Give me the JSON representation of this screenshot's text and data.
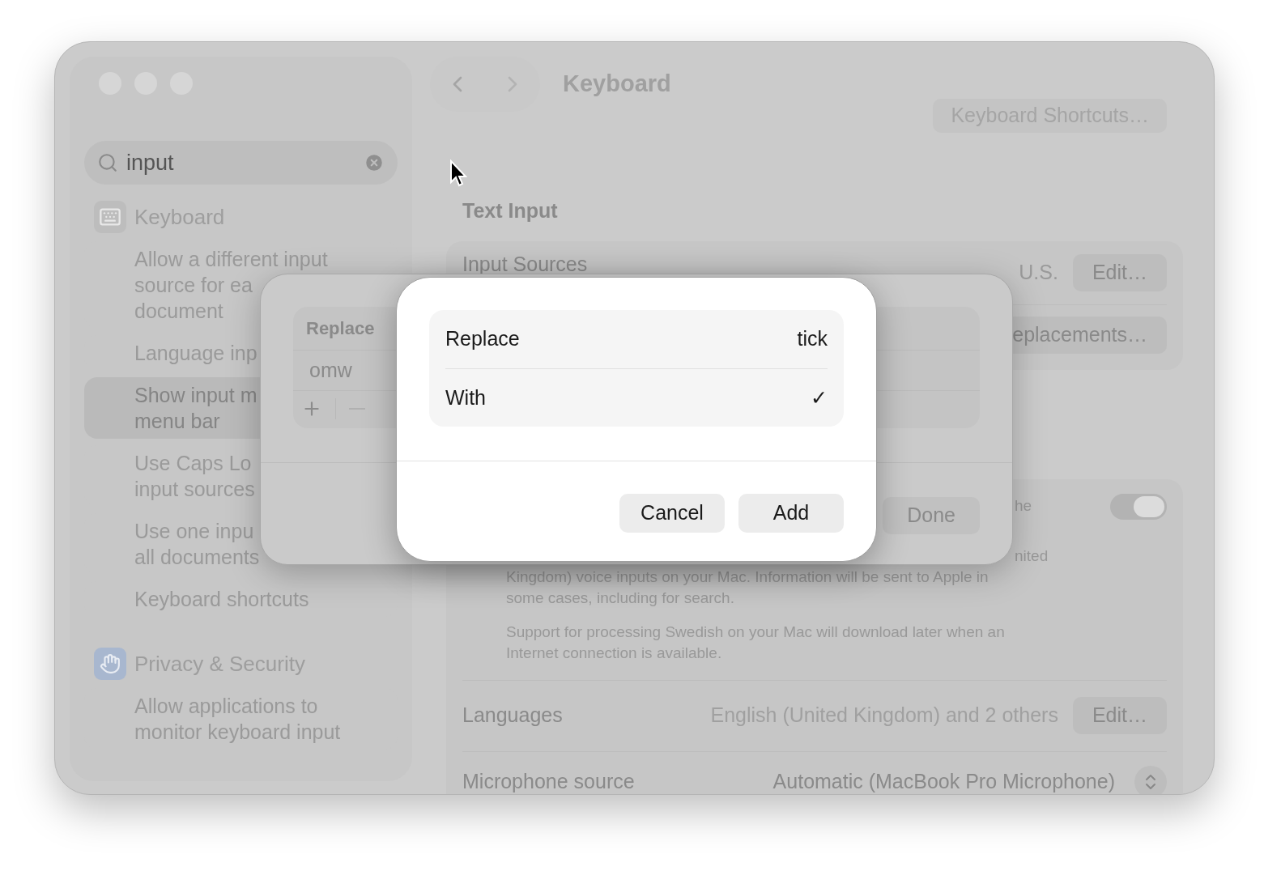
{
  "sidebar": {
    "search": {
      "value": "input"
    },
    "groups": [
      {
        "title": "Keyboard",
        "kind": "keyboard",
        "items": [
          {
            "lines": [
              "Allow a different input",
              "source for ea",
              "document"
            ],
            "selected": false
          },
          {
            "lines": [
              "Language inp"
            ],
            "selected": false
          },
          {
            "lines": [
              "Show input m",
              "menu bar"
            ],
            "selected": true
          },
          {
            "lines": [
              "Use Caps Lo",
              "input sources"
            ],
            "selected": false
          },
          {
            "lines": [
              "Use one inpu",
              "all documents"
            ],
            "selected": false
          },
          {
            "lines": [
              "Keyboard shortcuts"
            ],
            "selected": false
          }
        ]
      },
      {
        "title": "Privacy & Security",
        "kind": "hand",
        "items": [
          {
            "lines": [
              "Allow applications to",
              "monitor keyboard input"
            ],
            "selected": false
          }
        ]
      }
    ]
  },
  "toolbar": {
    "title": "Keyboard",
    "shortcuts_button": "Keyboard Shortcuts…"
  },
  "content": {
    "section_title": "Text Input",
    "input_sources": {
      "label": "Input Sources",
      "value": "U.S.",
      "button": "Edit…"
    },
    "replacements_button": "eplacements…",
    "dictation": {
      "fragments": [
        "he",
        "nited"
      ],
      "on": true,
      "paragraphs": [
        [
          "Kingdom) voice inputs on your Mac. Information will be sent to Apple in",
          "some cases, including for search."
        ],
        [
          "Support for processing Swedish on your Mac will download later when an",
          "Internet connection is available."
        ]
      ]
    },
    "languages": {
      "label": "Languages",
      "value": "English (United Kingdom) and 2 others",
      "button": "Edit…"
    },
    "microphone": {
      "label": "Microphone source",
      "value": "Automatic (MacBook Pro Microphone)"
    }
  },
  "sheet": {
    "column": "Replace",
    "rows": [
      "omw"
    ],
    "done": "Done"
  },
  "dialog": {
    "fields": [
      {
        "label": "Replace",
        "value": "tick"
      },
      {
        "label": "With",
        "value": "✓"
      }
    ],
    "buttons": [
      {
        "label": "Cancel"
      },
      {
        "label": "Add"
      }
    ]
  }
}
